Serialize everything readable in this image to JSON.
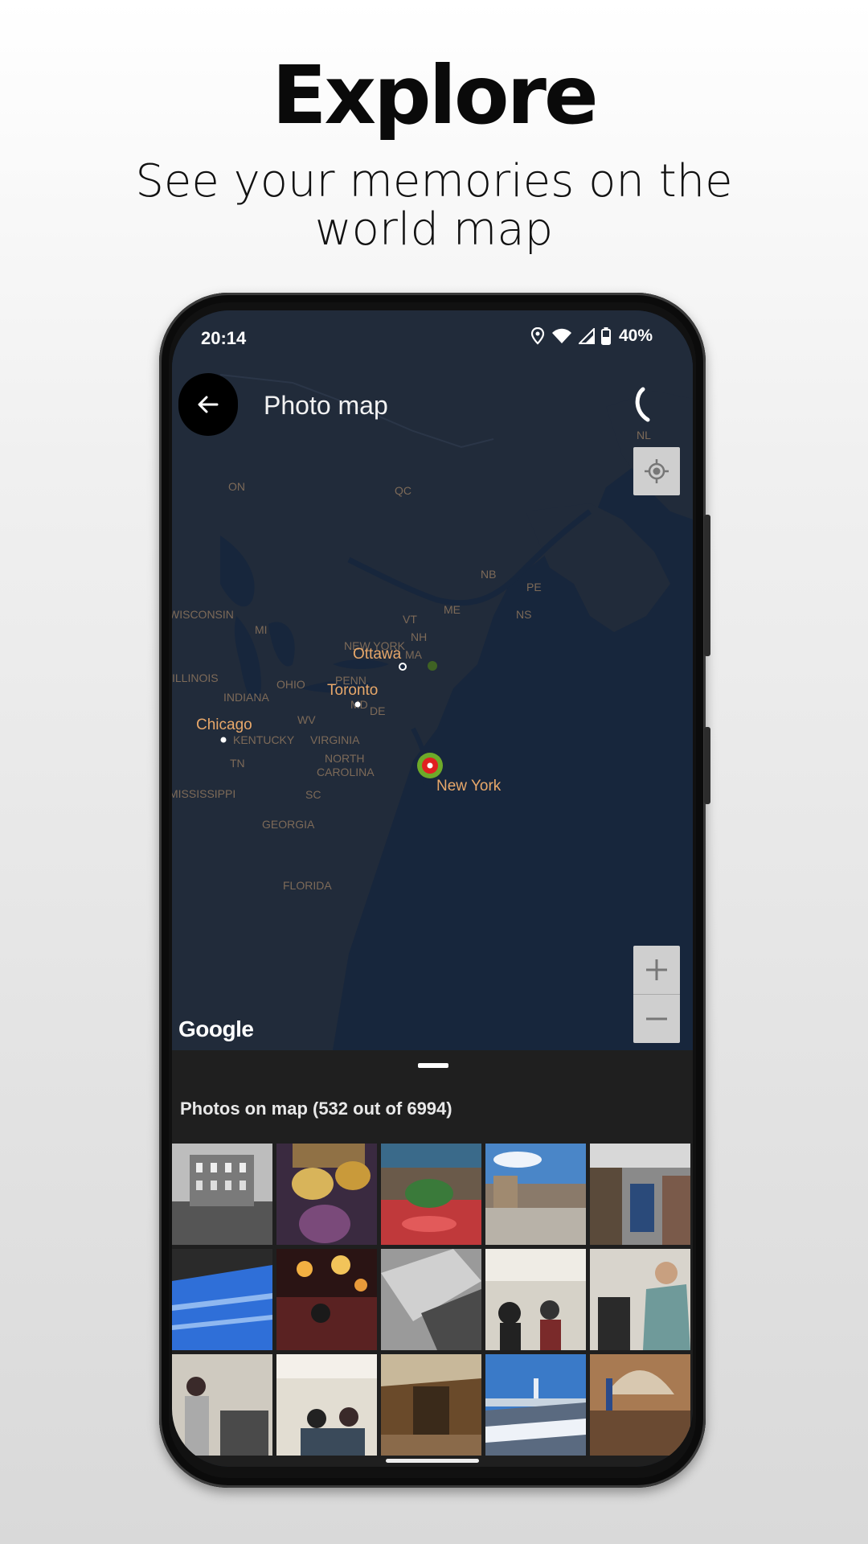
{
  "promo": {
    "headline": "Explore",
    "subline": "See your memories on the world map"
  },
  "status_bar": {
    "time": "20:14",
    "battery": "40%"
  },
  "app_bar": {
    "title": "Photo map"
  },
  "map": {
    "attribution": "Google",
    "cities": [
      {
        "name": "Ottawa"
      },
      {
        "name": "Toronto"
      },
      {
        "name": "Chicago"
      },
      {
        "name": "New York"
      }
    ],
    "region_labels": [
      "ON",
      "QC",
      "NL",
      "NB",
      "PE",
      "NS",
      "ME",
      "VT",
      "NH",
      "MA",
      "WISCONSIN",
      "MI",
      "NEW YORK",
      "ILLINOIS",
      "INDIANA",
      "OHIO",
      "PENN",
      "MD",
      "DE",
      "WV",
      "KENTUCKY",
      "VIRGINIA",
      "TN",
      "NORTH CAROLINA",
      "MISSISSIPPI",
      "SC",
      "GEORGIA",
      "FLORIDA"
    ],
    "colors": {
      "water": "#17263c",
      "land": "#212b3a",
      "city_label": "#e8a86a",
      "region_label": "#7d6a58",
      "marker": "#e02020",
      "marker_halo": "#7ec226"
    }
  },
  "sheet": {
    "title": "Photos on map (532 out of 6994)",
    "photos": [
      {
        "desc": "city-hall-night-bw"
      },
      {
        "desc": "beer-flight"
      },
      {
        "desc": "food-hall-red-floor"
      },
      {
        "desc": "plaza-blue-sky"
      },
      {
        "desc": "bookstore-interior"
      },
      {
        "desc": "departure-board"
      },
      {
        "desc": "bar-lights"
      },
      {
        "desc": "printer-tray"
      },
      {
        "desc": "hall-queue"
      },
      {
        "desc": "crowd-hoodie"
      },
      {
        "desc": "ticket-counter"
      },
      {
        "desc": "waiting-room"
      },
      {
        "desc": "museum-hall"
      },
      {
        "desc": "skyline-snow"
      },
      {
        "desc": "ellis-island-hall"
      }
    ]
  }
}
